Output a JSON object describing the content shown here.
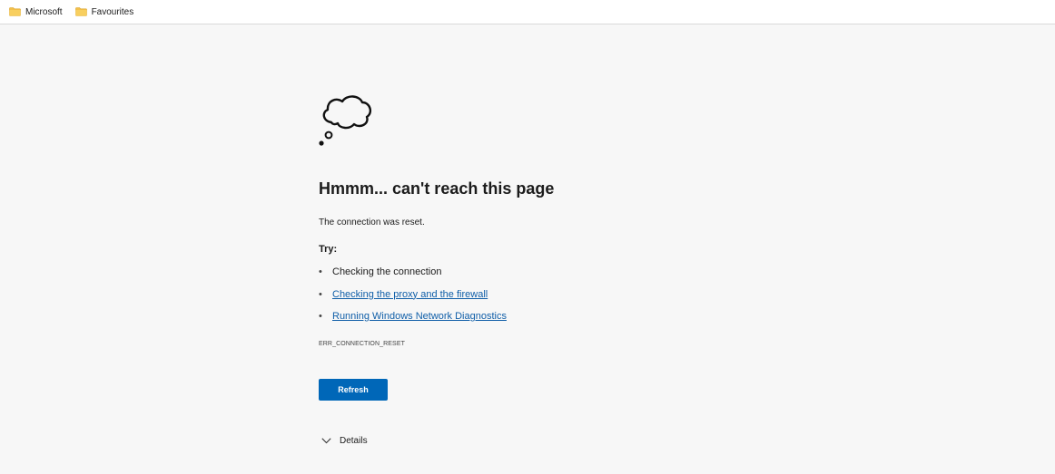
{
  "favorites_bar": {
    "items": [
      {
        "label": "Microsoft",
        "icon": "folder-icon"
      },
      {
        "label": "Favourites",
        "icon": "folder-icon"
      }
    ]
  },
  "error_page": {
    "icon": "thought-cloud-icon",
    "title": "Hmmm... can't reach this page",
    "description": "The connection was reset.",
    "try_label": "Try:",
    "suggestions": [
      {
        "text": "Checking the connection",
        "is_link": false
      },
      {
        "text": "Checking the proxy and the firewall",
        "is_link": true
      },
      {
        "text": "Running Windows Network Diagnostics",
        "is_link": true
      }
    ],
    "error_code": "ERR_CONNECTION_RESET",
    "refresh_label": "Refresh",
    "details_label": "Details"
  },
  "colors": {
    "accent": "#0067b8",
    "link": "#0f5ea8",
    "folder": "#f3c04b",
    "background": "#f7f7f7"
  }
}
